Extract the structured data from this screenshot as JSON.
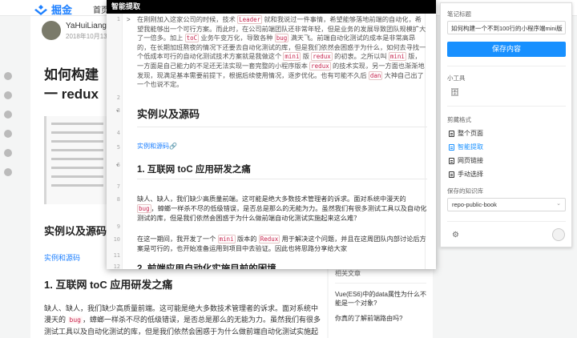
{
  "background": {
    "logo_text": "掘金",
    "nav_home": "首页",
    "author": "YaHuiLiang(R",
    "date": "2018年10月13日",
    "title": "如何构建一 redux",
    "h2": "实例以及源码",
    "link": "实例和源码",
    "h3": "1. 互联网 toC 应用研发之痛",
    "para_pre": "缺人、缺人，我们缺少高质量前端。这可能是绝大多数技术管理者的诉求。面对系统中漫天的",
    "para_code": "bug",
    "para_post": "，蟑螂一样杀不尽的低级错误，是否总是那么的无能为力。虽然我们有很多测试工具以及自动化测试的库，但是我们依然会困惑于为什么做前端自动化测试实施起来这么难？",
    "sidebar_title": "相关文章",
    "sidebar_item": "Vue(ES6)中的data属性为什么不能是一个对象?",
    "sidebar_item2": "你真的了解前端路由吗?"
  },
  "modal": {
    "header": "智能提取",
    "line_numbers": [
      "1",
      "2",
      "3",
      "4",
      "5",
      "6",
      "7",
      "8",
      "9",
      "10",
      "11",
      "12"
    ],
    "quote": [
      {
        "t": "在刚刚加入这家公司的时候，技术 "
      },
      {
        "c": "Leader"
      },
      {
        "t": " 就和我说过一件事情，希望能够落地前端的自动化，希望我能够出一个可行方案。而此时，在公司前端团队还非常年轻，但是业务的发展导致团队规模扩大了一倍多。加上 "
      },
      {
        "c": "toC"
      },
      {
        "t": " 业务午变万化，导致各种 "
      },
      {
        "c": "bug"
      },
      {
        "t": " 满天飞。前端自动化测试的成本是非常高昂的，在长期加班熬夜的情况下还要去自动化测试的库，但是我们依然会困惑于为什么，如何去寻找一个低成本可行的自动化测试技术方案就是我做这个 "
      },
      {
        "c": "mini"
      },
      {
        "t": " 版 "
      },
      {
        "c": "redux"
      },
      {
        "t": " 的初衷。之所以叫 "
      },
      {
        "c": "mini"
      },
      {
        "t": " 版，一方面是自己能力的不足还无法实现一套完整的小程序版本 "
      },
      {
        "c": "redux"
      },
      {
        "t": " 的技术实现，另一方面也渐渐地发现，现满足基本需要前提下，根据后续使用情况，逐步优化。也有可能不久后 "
      },
      {
        "c": "dan"
      },
      {
        "t": " 大神自己出了一个也说不定。"
      }
    ],
    "h2": "实例以及源码",
    "link": "实例和源码🔗",
    "h3": "1. 互联网 toC 应用研发之痛",
    "para1": [
      {
        "t": "缺人、缺人，我们缺少高质量前端。这可能是绝大多数技术管理者的诉求。面对系统中漫天的 "
      },
      {
        "c": "bug"
      },
      {
        "t": "，蟑螂一样杀不尽的低级错误，是否总是那么的无能为力。虽然我们有很多测试工具以及自动化测试的库，但是我们依然会困惑于为什么做前端自动化测试实施起来这么难？"
      }
    ],
    "para2": [
      {
        "t": "在这一期间，我开发了一个 "
      },
      {
        "c": "mini"
      },
      {
        "t": " 版本的 "
      },
      {
        "c": "Redux"
      },
      {
        "t": " 用于解决这个问题，并且在这周团队内部讨论后方案是可行的，也开始准备运用到项目中去验证。因此也将思路分享给大家"
      }
    ],
    "h4": "2. 前端应用自动化实施目前的困境"
  },
  "panel": {
    "title_label": "笔记标题",
    "title_value": "如何构建一个不到100行的小程序端mini版",
    "save_label": "保存内容",
    "tools_label": "小工具",
    "tool_icon": "archive-icon",
    "clip_label": "剪藏格式",
    "options": [
      "整个页面",
      "智能提取",
      "网页链接",
      "手动选择"
    ],
    "active_option": 1,
    "kb_label": "保存的知识库",
    "kb_value": "repo-public-book"
  },
  "colors": {
    "accent": "#1890ff",
    "code_text": "#c7254e",
    "header_bg": "#000000"
  }
}
